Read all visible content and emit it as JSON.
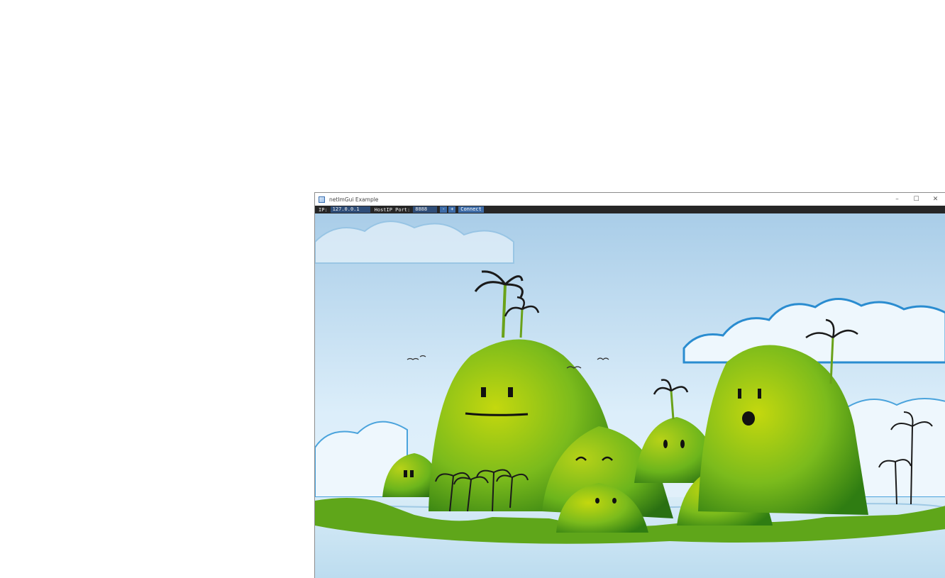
{
  "window": {
    "title": "netImGui Example",
    "icon": "app-window-icon",
    "controls": {
      "minimize": "–",
      "maximize": "☐",
      "close": "✕"
    }
  },
  "toolbar": {
    "ip_label": "IP:",
    "ip_value": "127.0.0.1",
    "port_label": "HostIP Port:",
    "port_value": "8888",
    "decrement_label": "-",
    "increment_label": "+",
    "connect_label": "Connect"
  },
  "background": {
    "description_icon": "island-wallpaper",
    "colors": {
      "sky_top": "#a9cde8",
      "sky_bottom": "#dceefa",
      "hill_green": "#6cb51c",
      "hill_dark": "#2f7d12",
      "water": "#cfe6f4"
    }
  }
}
